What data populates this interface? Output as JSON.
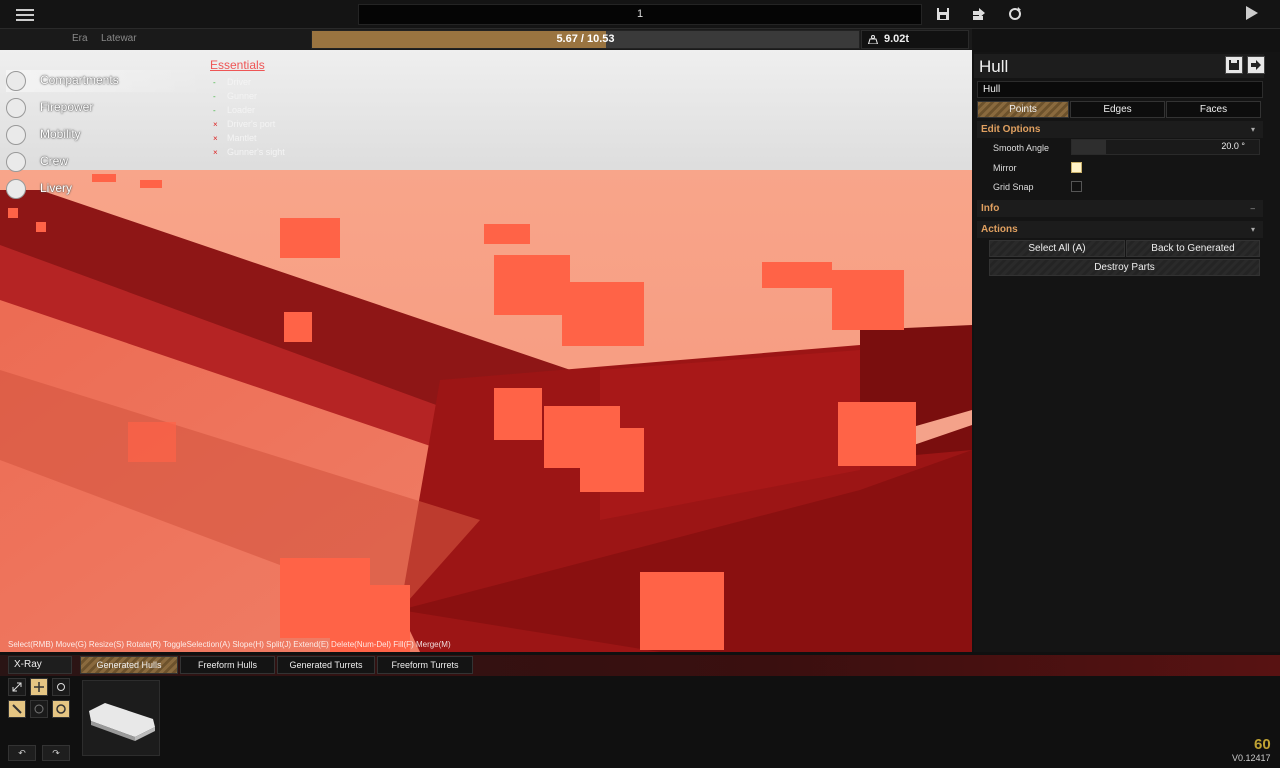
{
  "topbar": {
    "title_value": "1",
    "icons": [
      "menu-icon",
      "save-icon",
      "export-icon",
      "refresh-icon",
      "play-icon"
    ]
  },
  "status": {
    "era_label": "Era",
    "era_value": "Latewar",
    "points_text": "5.67 / 10.53",
    "points_fraction": 0.538,
    "weight": "9.02t"
  },
  "nav": {
    "items": [
      {
        "label": "Compartments",
        "icon": "cube-icon"
      },
      {
        "label": "Firepower",
        "icon": "gun-icon"
      },
      {
        "label": "Mobility",
        "icon": "wheel-icon"
      },
      {
        "label": "Crew",
        "icon": "person-icon"
      },
      {
        "label": "Livery",
        "icon": "brush-icon"
      }
    ]
  },
  "essentials": {
    "title": "Essentials",
    "items": [
      {
        "mark": "-",
        "label": "Driver",
        "ok": true
      },
      {
        "mark": "-",
        "label": "Gunner",
        "ok": true
      },
      {
        "mark": "-",
        "label": "Loader",
        "ok": true
      },
      {
        "mark": "×",
        "label": "Driver's port",
        "ok": false
      },
      {
        "mark": "×",
        "label": "Mantlet",
        "ok": false
      },
      {
        "mark": "×",
        "label": "Gunner's sight",
        "ok": false
      }
    ]
  },
  "hints": "Select(RMB) Move(G) Resize(S) Rotate(R) ToggleSelection(A) Slope(H) Split(J) Extend(E) Delete(Num-Del) Fill(F) Merge(M)",
  "panel": {
    "title": "Hull",
    "name_value": "Hull",
    "tabs": [
      "Points",
      "Edges",
      "Faces"
    ],
    "edit_options": {
      "header": "Edit Options",
      "toggle": "▾",
      "smooth_angle_label": "Smooth Angle",
      "smooth_angle_value": "20.0 °",
      "mirror_label": "Mirror",
      "mirror_checked": true,
      "grid_snap_label": "Grid Snap",
      "grid_snap_checked": false
    },
    "info": {
      "header": "Info",
      "toggle": "–"
    },
    "actions": {
      "header": "Actions",
      "toggle": "▾",
      "select_all": "Select All (A)",
      "back_to_generated": "Back to Generated",
      "destroy_parts": "Destroy Parts"
    }
  },
  "bottom": {
    "xray": "X-Ray",
    "tabs": [
      "Generated Hulls",
      "Freeform Hulls",
      "Generated Turrets",
      "Freeform Turrets"
    ],
    "undo": "↶",
    "redo": "↷"
  },
  "fps": "60",
  "version": "V0.12417",
  "colors": {
    "accent": "#9a7440",
    "warning": "#ee5555",
    "ok": "#3bb33b",
    "fps": "#bfa233",
    "header_text": "#e0a060"
  }
}
